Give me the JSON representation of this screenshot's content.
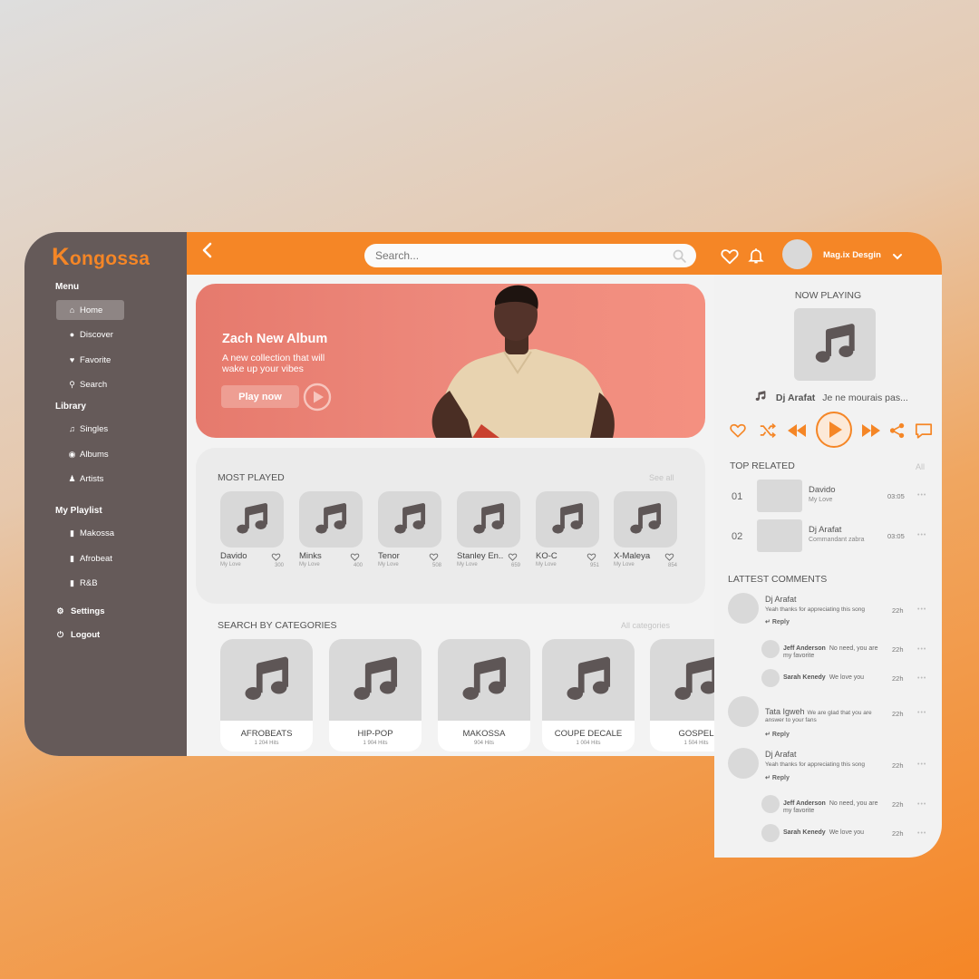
{
  "brand": {
    "name": "ongossa",
    "initial": "K",
    "accent": "#F58626"
  },
  "sidebar": {
    "menu_title": "Menu",
    "menu_items": [
      {
        "label": "Home",
        "icon": "home-icon",
        "active": true
      },
      {
        "label": "Discover",
        "icon": "compass-icon"
      },
      {
        "label": "Favorite",
        "icon": "heart-icon"
      },
      {
        "label": "Search",
        "icon": "search-icon"
      }
    ],
    "library_title": "Library",
    "library_items": [
      {
        "label": "Singles",
        "icon": "music-note-icon"
      },
      {
        "label": "Albums",
        "icon": "disc-icon"
      },
      {
        "label": "Artists",
        "icon": "user-icon"
      }
    ],
    "playlist_title": "My Playlist",
    "playlist_items": [
      {
        "label": "Makossa",
        "icon": "bookmark-icon"
      },
      {
        "label": "Afrobeat",
        "icon": "bookmark-icon"
      },
      {
        "label": "R&B",
        "icon": "bookmark-icon"
      }
    ],
    "settings_label": "Settings",
    "logout_label": "Logout"
  },
  "header": {
    "search_placeholder": "Search...",
    "user_name": "Mag.ix Desgin"
  },
  "hero": {
    "title": "Zach New Album",
    "subtitle": "A new collection that will wake up your vibes",
    "cta": "Play now"
  },
  "most_played": {
    "title": "MOST PLAYED",
    "see_all": "See all",
    "items": [
      {
        "name": "Davido",
        "sub": "My Love",
        "count": "300"
      },
      {
        "name": "Minks",
        "sub": "My Love",
        "count": "400"
      },
      {
        "name": "Tenor",
        "sub": "My Love",
        "count": "508"
      },
      {
        "name": "Stanley En..",
        "sub": "My Love",
        "count": "659"
      },
      {
        "name": "KO-C",
        "sub": "My Love",
        "count": "951"
      },
      {
        "name": "X-Maleya",
        "sub": "My Love",
        "count": "854"
      }
    ]
  },
  "categories": {
    "title": "SEARCH BY CATEGORIES",
    "all_label": "All categories",
    "items": [
      {
        "name": "AFROBEATS",
        "hits": "1 204 Hits"
      },
      {
        "name": "HIP-POP",
        "hits": "1 904 Hits"
      },
      {
        "name": "MAKOSSA",
        "hits": "904 Hits"
      },
      {
        "name": "COUPE DECALE",
        "hits": "1 004 Hits"
      },
      {
        "name": "GOSPEL",
        "hits": "1 504 Hits"
      }
    ]
  },
  "now_playing": {
    "title": "NOW PLAYING",
    "artist": "Dj Arafat",
    "track": "Je ne mourais pas..."
  },
  "top_related": {
    "title": "TOP RELATED",
    "all_label": "All",
    "items": [
      {
        "num": "01",
        "name": "Davido",
        "sub": "My Love",
        "time": "03:05"
      },
      {
        "num": "02",
        "name": "Dj Arafat",
        "sub": "Commandant zabra",
        "time": "03:05"
      }
    ]
  },
  "comments": {
    "title": "LATTEST COMMENTS",
    "reply_label": "Reply",
    "c1": {
      "name": "Dj Arafat",
      "text": "Yeah thanks for appreciating this song",
      "time": "22h"
    },
    "c1r1": {
      "name": "Jeff Anderson",
      "text": "No need, you are my favorite",
      "time": "22h"
    },
    "c1r2": {
      "name": "Sarah Kenedy",
      "text": "We love you",
      "time": "22h"
    },
    "c2": {
      "name": "Tata Igweh",
      "text": "We are glad that you are answer to your fans",
      "time": "22h"
    },
    "c3": {
      "name": "Dj Arafat",
      "text": "Yeah thanks for appreciating this song",
      "time": "22h"
    },
    "c3r1": {
      "name": "Jeff Anderson",
      "text": "No need, you are my favorite",
      "time": "22h"
    },
    "c3r2": {
      "name": "Sarah Kenedy",
      "text": "We love you",
      "time": "22h"
    }
  }
}
